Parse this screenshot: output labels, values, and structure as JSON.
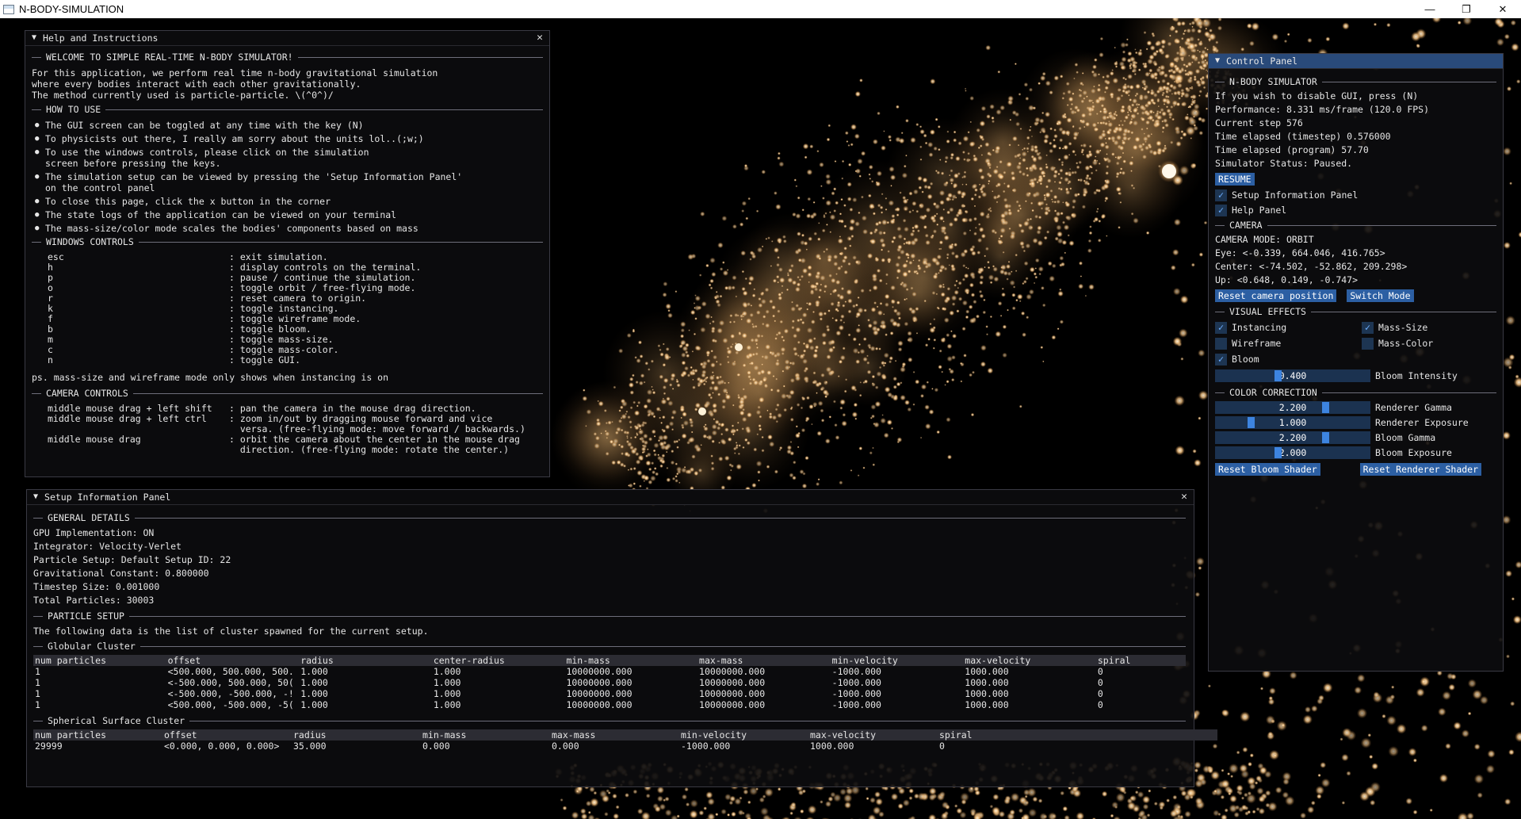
{
  "window": {
    "title": "N-BODY-SIMULATION",
    "minimize": "—",
    "restore": "❐",
    "close": "✕"
  },
  "help": {
    "title": "Help and Instructions",
    "welcome_header": "WELCOME TO SIMPLE REAL-TIME N-BODY SIMULATOR!",
    "intro": "For this application, we perform real time n-body gravitational simulation\nwhere every bodies interact with each other gravitationally.\nThe method currently used is particle-particle. \\(^0^)/",
    "howto_header": "HOW TO USE",
    "howto": [
      "The GUI screen can be toggled at any time with the key (N)",
      "To physicists out there, I really am sorry about the units lol..(;w;)",
      "To use the windows controls, please click on the simulation\nscreen before pressing the keys.",
      "The simulation setup can be viewed by pressing the 'Setup Information Panel'\non the control panel",
      "To close this page, click the x button in the corner",
      "The state logs of the application can be viewed on your terminal",
      "The mass-size/color mode scales the bodies' components based on mass"
    ],
    "windows_header": "WINDOWS CONTROLS",
    "keys": [
      {
        "k": "esc",
        "v": ": exit simulation."
      },
      {
        "k": "h",
        "v": ": display controls on the terminal."
      },
      {
        "k": "p",
        "v": ": pause / continue the simulation."
      },
      {
        "k": "o",
        "v": ": toggle orbit / free-flying mode."
      },
      {
        "k": "r",
        "v": ": reset camera to origin."
      },
      {
        "k": "k",
        "v": ": toggle instancing."
      },
      {
        "k": "f",
        "v": ": toggle wireframe mode."
      },
      {
        "k": "b",
        "v": ": toggle bloom."
      },
      {
        "k": "m",
        "v": ": toggle mass-size."
      },
      {
        "k": "c",
        "v": ": toggle mass-color."
      },
      {
        "k": "n",
        "v": ": toggle GUI."
      }
    ],
    "ps": "ps. mass-size and wireframe mode only shows when instancing is on",
    "camera_header": "CAMERA CONTROLS",
    "camera": [
      {
        "k": "middle mouse drag + left shift",
        "v": ": pan the camera in the mouse drag direction."
      },
      {
        "k": "middle mouse drag + left ctrl",
        "v": ": zoom in/out by dragging mouse forward and vice\n  versa. (free-flying mode: move forward / backwards.)"
      },
      {
        "k": "middle mouse drag",
        "v": ": orbit the camera about the center in the mouse drag\n  direction. (free-flying mode: rotate the center.)"
      }
    ]
  },
  "setup": {
    "title": "Setup Information Panel",
    "general_header": "GENERAL DETAILS",
    "general": [
      "GPU Implementation: ON",
      "Integrator: Velocity-Verlet",
      "Particle Setup: Default Setup ID: 22",
      "Gravitational Constant: 0.800000",
      "Timestep Size: 0.001000",
      "Total Particles: 30003"
    ],
    "particle_header": "PARTICLE SETUP",
    "particle_text": "The following data is the list of cluster spawned for the current setup.",
    "globular_header": "Globular Cluster",
    "globular_columns": [
      "num particles",
      "offset",
      "radius",
      "center-radius",
      "min-mass",
      "max-mass",
      "min-velocity",
      "max-velocity",
      "spiral"
    ],
    "globular_rows": [
      [
        "1",
        "<500.000, 500.000, 500.",
        "1.000",
        "1.000",
        "10000000.000",
        "10000000.000",
        "-1000.000",
        "1000.000",
        "0"
      ],
      [
        "1",
        "<-500.000, 500.000, 50(",
        "1.000",
        "1.000",
        "10000000.000",
        "10000000.000",
        "-1000.000",
        "1000.000",
        "0"
      ],
      [
        "1",
        "<-500.000, -500.000, -!",
        "1.000",
        "1.000",
        "10000000.000",
        "10000000.000",
        "-1000.000",
        "1000.000",
        "0"
      ],
      [
        "1",
        "<500.000, -500.000, -5(",
        "1.000",
        "1.000",
        "10000000.000",
        "10000000.000",
        "-1000.000",
        "1000.000",
        "0"
      ]
    ],
    "spherical_header": "Spherical Surface Cluster",
    "spherical_columns": [
      "num particles",
      "offset",
      "radius",
      "min-mass",
      "max-mass",
      "min-velocity",
      "max-velocity",
      "spiral"
    ],
    "spherical_rows": [
      [
        "29999",
        "<0.000, 0.000, 0.000>",
        "35.000",
        "0.000",
        "0.000",
        "-1000.000",
        "1000.000",
        "0"
      ]
    ]
  },
  "control": {
    "title": "Control Panel",
    "nbody_header": "N-BODY SIMULATOR",
    "lines": [
      "If you wish to disable GUI, press (N)",
      "Performance: 8.331 ms/frame (120.0 FPS)",
      "Current step 576",
      "Time elapsed (timestep) 0.576000",
      "Time elapsed (program) 57.70",
      "Simulator Status: Paused."
    ],
    "resume": "RESUME",
    "setup_panel_label": "Setup Information Panel",
    "setup_panel_checked": true,
    "help_panel_label": "Help Panel",
    "help_panel_checked": true,
    "camera_header": "CAMERA",
    "camera_lines": [
      "CAMERA MODE: ORBIT",
      "Eye: <-0.339, 664.046, 416.765>",
      "Center: <-74.502, -52.862, 209.298>",
      "Up: <0.648, 0.149, -0.747>"
    ],
    "reset_camera": "Reset camera position",
    "switch_mode": "Switch Mode",
    "visual_header": "VISUAL EFFECTS",
    "toggles": [
      {
        "label": "Instancing",
        "checked": true
      },
      {
        "label": "Mass-Size",
        "checked": true
      },
      {
        "label": "Wireframe",
        "checked": false
      },
      {
        "label": "Mass-Color",
        "checked": false
      },
      {
        "label": "Bloom",
        "checked": true
      }
    ],
    "bloom_intensity": {
      "value": "0.400",
      "label": "Bloom Intensity",
      "fraction": 0.4
    },
    "color_header": "COLOR CORRECTION",
    "sliders": [
      {
        "value": "2.200",
        "label": "Renderer Gamma",
        "fraction": 0.72
      },
      {
        "value": "1.000",
        "label": "Renderer Exposure",
        "fraction": 0.22
      },
      {
        "value": "2.200",
        "label": "Bloom Gamma",
        "fraction": 0.72
      },
      {
        "value": "2.000",
        "label": "Bloom Exposure",
        "fraction": 0.4
      }
    ],
    "reset_bloom": "Reset Bloom Shader",
    "reset_renderer": "Reset Renderer Shader"
  },
  "colors": {
    "accent": "#2c5fa3",
    "particle": "#f6c98f",
    "title_active": "#294a7a"
  }
}
